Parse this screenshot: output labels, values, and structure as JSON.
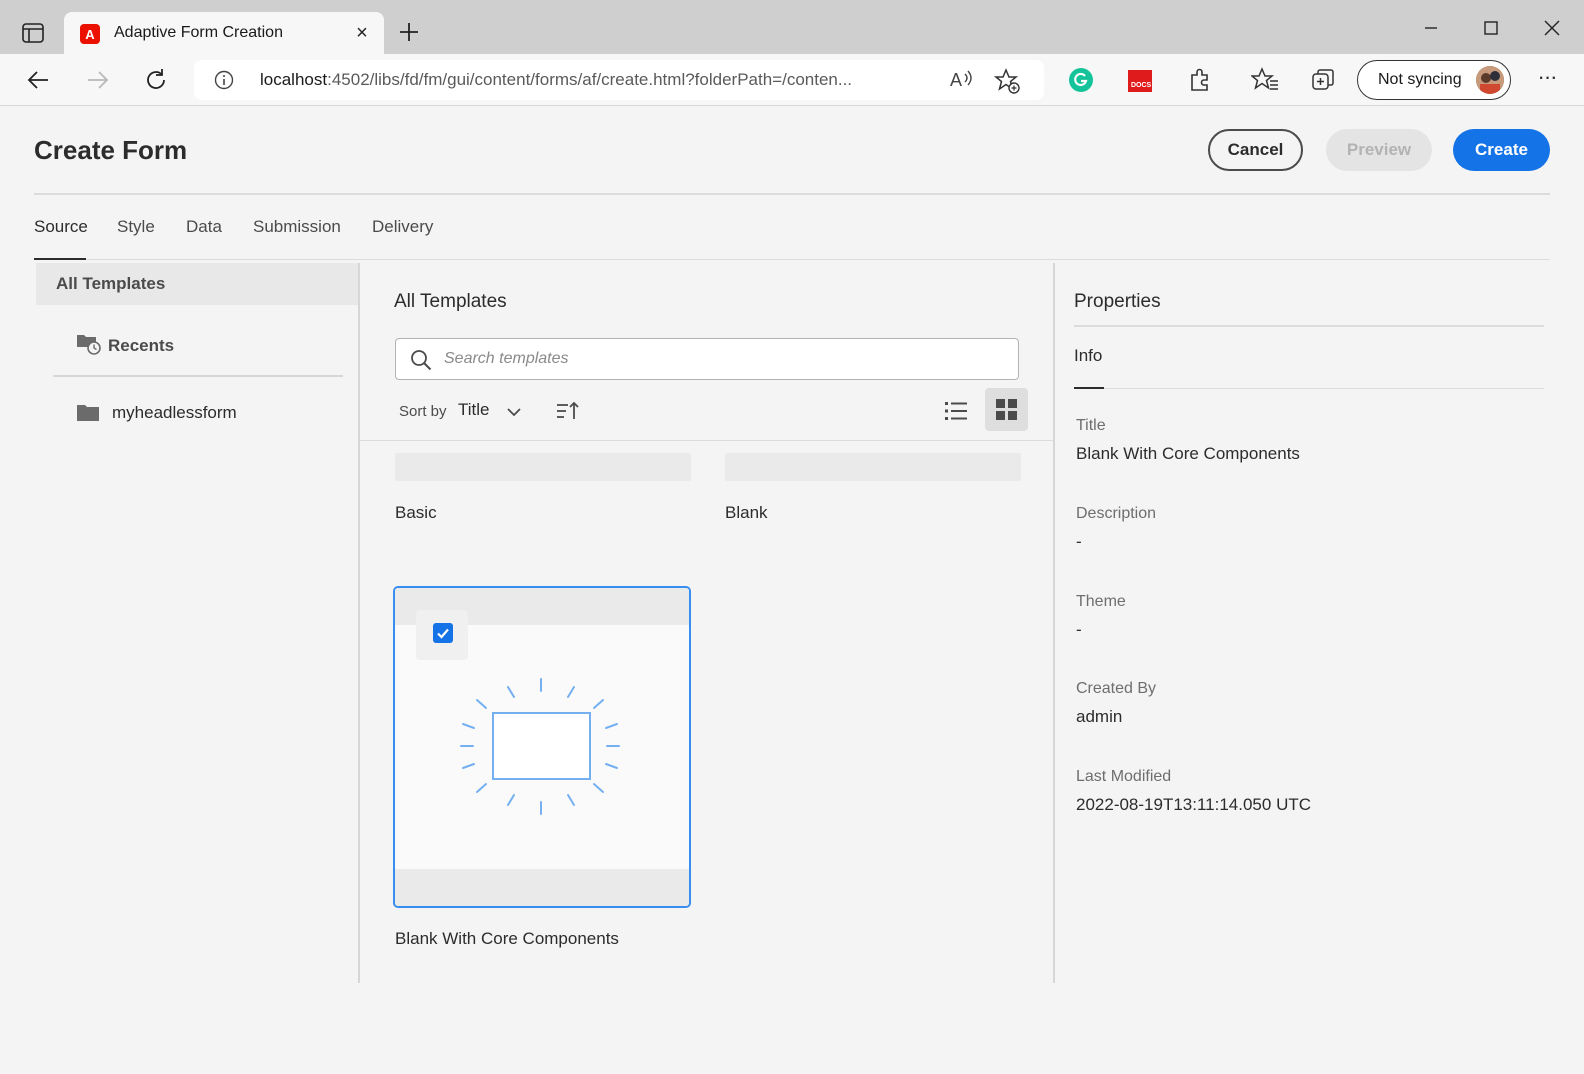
{
  "browser": {
    "tab_title": "Adaptive Form Creation",
    "tab_favicon": "A",
    "url_host": "localhost",
    "url_rest": ":4502/libs/fd/fm/gui/content/forms/af/create.html?folderPath=/conten...",
    "read_aloud_glyph": "A))",
    "sync_label": "Not syncing",
    "more_glyph": "···",
    "close_tab_glyph": "×"
  },
  "page": {
    "title": "Create Form",
    "buttons": {
      "cancel": "Cancel",
      "preview": "Preview",
      "create": "Create"
    },
    "tabs": [
      "Source",
      "Style",
      "Data",
      "Submission",
      "Delivery"
    ]
  },
  "left_nav": {
    "all_templates": "All Templates",
    "recents": "Recents",
    "folder": "myheadlessform"
  },
  "templates": {
    "heading": "All Templates",
    "search_placeholder": "Search templates",
    "sort_by_label": "Sort by",
    "sort_value": "Title",
    "items": [
      {
        "label": "Basic"
      },
      {
        "label": "Blank"
      },
      {
        "label": "Blank With Core Components",
        "selected": true
      }
    ]
  },
  "properties": {
    "heading": "Properties",
    "tab": "Info",
    "fields": [
      {
        "label": "Title",
        "value": "Blank With Core Components"
      },
      {
        "label": "Description",
        "value": "-"
      },
      {
        "label": "Theme",
        "value": "-"
      },
      {
        "label": "Created By",
        "value": "admin"
      },
      {
        "label": "Last Modified",
        "value": "2022-08-19T13:11:14.050 UTC"
      }
    ]
  },
  "colors": {
    "accent": "#1473e6",
    "selection_border": "#378ef0",
    "adobe_red": "#eb1000"
  }
}
